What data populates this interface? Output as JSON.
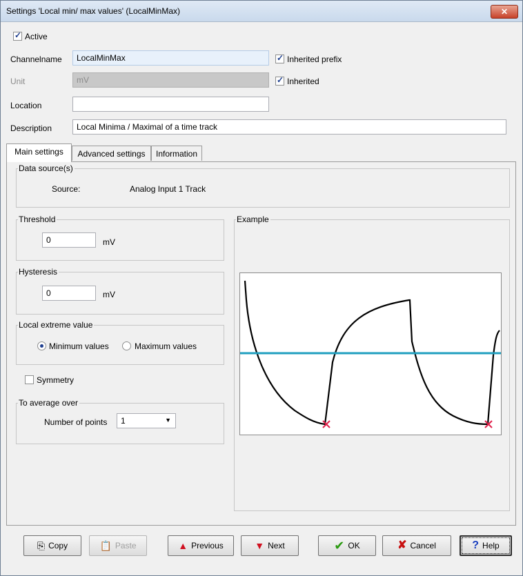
{
  "window": {
    "title": "Settings 'Local min/ max values' (LocalMinMax)",
    "close_label": "✕"
  },
  "header": {
    "active_label": "Active",
    "channelname_label": "Channelname",
    "channelname_value": "LocalMinMax",
    "inherited_prefix_label": "Inherited prefix",
    "unit_label": "Unit",
    "unit_value": "mV",
    "inherited_label": "Inherited",
    "location_label": "Location",
    "location_value": "",
    "description_label": "Description",
    "description_value": "Local Minima / Maximal of a time track",
    "checks": {
      "active": true,
      "inherited_prefix": true,
      "inherited": true
    }
  },
  "tabs": [
    "Main settings",
    "Advanced settings",
    "Information"
  ],
  "main": {
    "data_source_legend": "Data source(s)",
    "source_label": "Source:",
    "source_value": "Analog Input 1 Track",
    "threshold_legend": "Threshold",
    "threshold_value": "0",
    "threshold_unit": "mV",
    "hysteresis_legend": "Hysteresis",
    "hysteresis_value": "0",
    "hysteresis_unit": "mV",
    "extreme_legend": "Local extreme value",
    "minimum_label": "Minimum values",
    "maximum_label": "Maximum values",
    "selected_extreme": "minimum",
    "symmetry_label": "Symmetry",
    "symmetry_checked": false,
    "average_legend": "To average over",
    "points_label": "Number of points",
    "points_value": "1",
    "example_legend": "Example"
  },
  "buttons": {
    "copy": "Copy",
    "paste": "Paste",
    "previous": "Previous",
    "next": "Next",
    "ok": "OK",
    "cancel": "Cancel",
    "help": "Help"
  },
  "colors": {
    "threshold_line": "#1f9fbf",
    "marker": "#e0204a",
    "signal": "#000000"
  }
}
